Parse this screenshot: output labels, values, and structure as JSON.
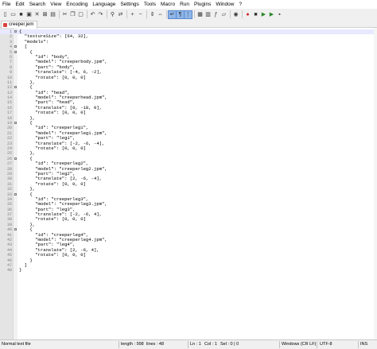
{
  "menu": [
    "File",
    "Edit",
    "Search",
    "View",
    "Encoding",
    "Language",
    "Settings",
    "Tools",
    "Macro",
    "Run",
    "Plugins",
    "Window",
    "?"
  ],
  "toolbar_icons": [
    "new-file-icon",
    "open-file-icon",
    "save-icon",
    "save-all-icon",
    "close-icon",
    "close-all-icon",
    "print-icon",
    "sep",
    "cut-icon",
    "copy-icon",
    "paste-icon",
    "sep",
    "undo-icon",
    "redo-icon",
    "sep",
    "find-icon",
    "replace-icon",
    "sep",
    "zoom-in-icon",
    "zoom-out-icon",
    "sep",
    "sync-v-icon",
    "sync-h-icon",
    "sep",
    "wrap-icon",
    "all-chars-icon",
    "indent-guide-icon",
    "sep",
    "udl-icon",
    "doc-map-icon",
    "function-list-icon",
    "folder-workspace-icon",
    "sep",
    "monitor-icon",
    "sep",
    "record-macro-icon",
    "stop-macro-icon",
    "play-macro-icon",
    "run-macro-multiple-icon",
    "save-macro-icon"
  ],
  "tab": {
    "label": "creeper.jem"
  },
  "editor": {
    "lines": [
      "{",
      "  \"textureSize\": [64, 32],",
      "  \"models\":",
      "  [",
      "    {",
      "      \"id\": \"body\",",
      "      \"model\": \"creeperbody.jpm\",",
      "      \"part\": \"body\",",
      "      \"translate\": [-4, 6, -2],",
      "      \"rotate\": [0, 0, 0]",
      "    },",
      "    {",
      "      \"id\": \"head\",",
      "      \"model\": \"creeperhead.jpm\",",
      "      \"part\": \"head\",",
      "      \"translate\": [0, -18, 0],",
      "      \"rotate\": [0, 0, 0]",
      "    },",
      "    {",
      "      \"id\": \"creeperleg1\",",
      "      \"model\": \"creeperleg1.jpm\",",
      "      \"part\": \"leg1\",",
      "      \"translate\": [-2, -6, -4],",
      "      \"rotate\": [0, 0, 0]",
      "    },",
      "    {",
      "      \"id\": \"creeperleg2\",",
      "      \"model\": \"creeperleg2.jpm\",",
      "      \"part\": \"leg2\",",
      "      \"translate\": [2, -6, -4],",
      "      \"rotate\": [0, 0, 0]",
      "    },",
      "    {",
      "      \"id\": \"creeperleg3\",",
      "      \"model\": \"creeperleg3.jpm\",",
      "      \"part\": \"leg3\",",
      "      \"translate\": [-2, -6, 4],",
      "      \"rotate\": [0, 0, 0]",
      "    },",
      "    {",
      "      \"id\": \"creeperleg4\",",
      "      \"model\": \"creeperleg4.jpm\",",
      "      \"part\": \"leg4\",",
      "      \"translate\": [2, -6, 4],",
      "      \"rotate\": [0, 0, 0]",
      "    }",
      "  ]",
      "}"
    ],
    "fold_lines": [
      1,
      4,
      5,
      12,
      19,
      26,
      33,
      40
    ]
  },
  "status": {
    "file_type": "Normal text file",
    "length": "length : 998",
    "lines": "lines : 48",
    "ln": "Ln : 1",
    "col": "Col : 1",
    "sel": "Sel : 0 | 0",
    "eol": "Windows (CR LF)",
    "encoding": "UTF-8",
    "mode": "INS"
  },
  "colors": {
    "accent": "#8fb6e8",
    "current_line": "#e8e8ff",
    "gutter": "#e4e4e4"
  }
}
